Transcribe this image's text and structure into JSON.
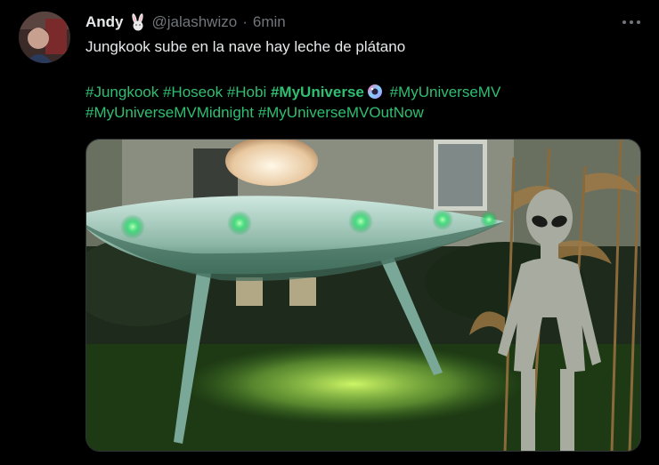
{
  "user": {
    "name": "Andy",
    "emoji": "rabbit-emoji",
    "handle": "@jalashwizo",
    "separator": "·",
    "time": "6min"
  },
  "tweet": {
    "text": "Jungkook sube en la nave hay leche de plátano",
    "hashtags_line1": [
      "#Jungkook",
      "#Hoseok",
      "#Hobi",
      "#MyUniverse",
      "#MyUniverseMV"
    ],
    "hashtags_line2": [
      "#MyUniverseMVMidnight",
      "#MyUniverseMVOutNow"
    ]
  },
  "colors": {
    "background": "#000000",
    "hashtag": "#2fbf71",
    "secondary_text": "#71767b"
  },
  "icons": [
    "more-icon",
    "rabbit-emoji",
    "hashflag-icon"
  ]
}
